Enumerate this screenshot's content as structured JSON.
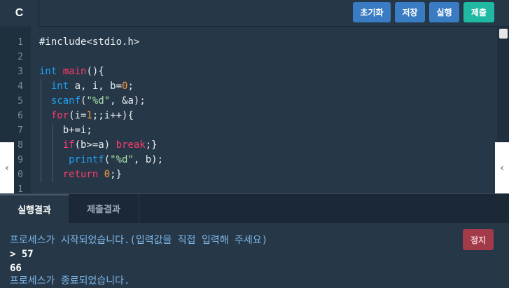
{
  "toolbar": {
    "language": "C",
    "buttons": {
      "reset": "초기화",
      "save": "저장",
      "run": "실행",
      "submit": "제출"
    }
  },
  "editor": {
    "line_numbers": [
      "1",
      "2",
      "3",
      "4",
      "5",
      "6",
      "7",
      "8",
      "9",
      "0",
      "1"
    ],
    "code": [
      "#include<stdio.h>",
      "",
      "int main(){",
      "  int a, i, b=0;",
      "  scanf(\"%d\", &a);",
      "  for(i=1;;i++){",
      "    b+=i;",
      "    if(b>=a) break;}",
      "     printf(\"%d\", b);",
      "    return 0;}",
      ""
    ]
  },
  "tabs": {
    "result": "실행결과",
    "submission": "제출결과"
  },
  "console": {
    "start_message": "프로세스가 시작되었습니다.(입력값을 직접 입력해 주세요)",
    "input_line": "> 57",
    "output_line": "66",
    "end_message": "프로세스가 종료되었습니다.",
    "stop_label": "정지"
  },
  "colors": {
    "background": "#263747",
    "button_blue": "#3a7cc3",
    "button_teal": "#1fb9a3",
    "stop_red": "#a23a4a"
  }
}
